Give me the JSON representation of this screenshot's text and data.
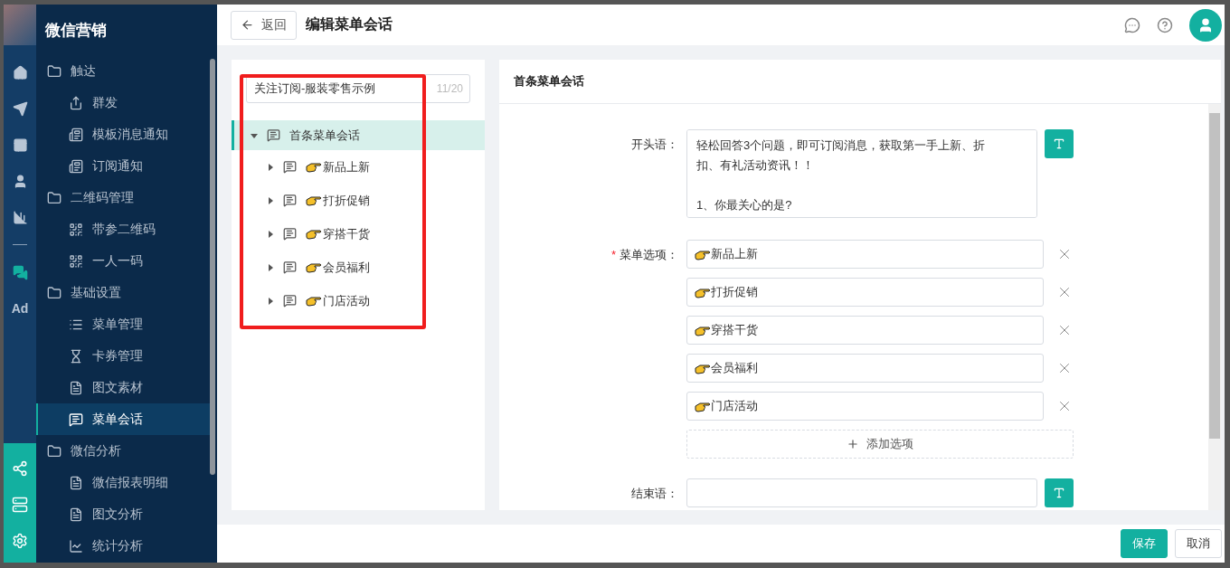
{
  "rail": {
    "ad_label": "Ad"
  },
  "sidebar": {
    "title": "微信营销",
    "groups": [
      {
        "label": "触达",
        "children": [
          {
            "label": "群发",
            "selected": false
          },
          {
            "label": "模板消息通知",
            "selected": false
          },
          {
            "label": "订阅通知",
            "selected": false
          }
        ]
      },
      {
        "label": "二维码管理",
        "children": [
          {
            "label": "带参二维码",
            "selected": false
          },
          {
            "label": "一人一码",
            "selected": false
          }
        ]
      },
      {
        "label": "基础设置",
        "children": [
          {
            "label": "菜单管理",
            "selected": false
          },
          {
            "label": "卡券管理",
            "selected": false
          },
          {
            "label": "图文素材",
            "selected": false
          },
          {
            "label": "菜单会话",
            "selected": true
          }
        ]
      },
      {
        "label": "微信分析",
        "children": [
          {
            "label": "微信报表明细",
            "selected": false
          },
          {
            "label": "图文分析",
            "selected": false
          },
          {
            "label": "统计分析",
            "selected": false
          }
        ]
      }
    ]
  },
  "header": {
    "back_label": "返回",
    "title": "编辑菜单会话"
  },
  "left_panel": {
    "name_input": {
      "value": "关注订阅-服装零售示例",
      "count": "11/20"
    },
    "tree": [
      {
        "label": "首条菜单会话",
        "expanded": true,
        "selected": true,
        "children": [
          {
            "label": "新品上新",
            "expanded": false,
            "selected": false
          },
          {
            "label": "打折促销",
            "expanded": false,
            "selected": false
          },
          {
            "label": "穿搭干货",
            "expanded": false,
            "selected": false
          },
          {
            "label": "会员福利",
            "expanded": false,
            "selected": false
          },
          {
            "label": "门店活动",
            "expanded": false,
            "selected": false
          }
        ]
      }
    ]
  },
  "right_panel": {
    "title": "首条菜单会话",
    "opening": {
      "label": "开头语：",
      "value": "轻松回答3个问题，即可订阅消息，获取第一手上新、折扣、有礼活动资讯！！\n\n1、你最关心的是?"
    },
    "options": {
      "label": "菜单选项：",
      "required_mark": "*",
      "items": [
        "新品上新",
        "打折促销",
        "穿搭干货",
        "会员福利",
        "门店活动"
      ],
      "add_label": "添加选项"
    },
    "closing": {
      "label": "结束语："
    }
  },
  "footer": {
    "buttons": [
      {
        "label": "保存",
        "kind": "primary"
      },
      {
        "label": "取消",
        "kind": "default"
      }
    ]
  }
}
